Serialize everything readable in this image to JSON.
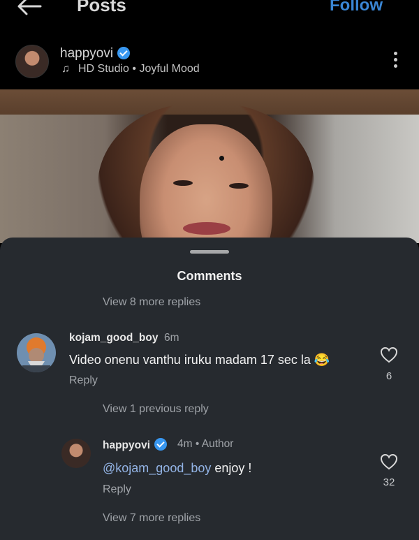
{
  "header": {
    "title": "Posts",
    "follow_label": "Follow"
  },
  "post": {
    "username": "happyovi",
    "audio": "HD Studio",
    "separator": "•",
    "mood": "Joyful Mood"
  },
  "comments_sheet": {
    "title": "Comments",
    "view_more_top": "View 8 more replies",
    "comment1": {
      "username": "kojam_good_boy",
      "time": "6m",
      "text": "Video onenu vanthu iruku madam 17 sec la 😂",
      "reply": "Reply",
      "likes": "6"
    },
    "view_previous": "View 1 previous reply",
    "comment2": {
      "username": "happyovi",
      "time": "4m",
      "separator": "•",
      "badge": "Author",
      "mention": "@kojam_good_boy",
      "text": " enjoy !",
      "reply": "Reply",
      "likes": "32"
    },
    "view_more_bottom": "View 7 more replies"
  }
}
